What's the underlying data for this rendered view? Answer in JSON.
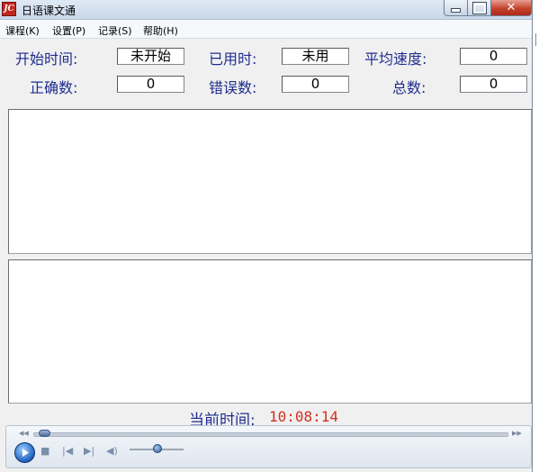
{
  "window": {
    "title": "日语课文通",
    "icon_text": "JC",
    "icon_color": "#c0281e"
  },
  "menu": [
    {
      "label": "课程(K)"
    },
    {
      "label": "设置(P)"
    },
    {
      "label": "记录(S)"
    },
    {
      "label": "帮助(H)"
    }
  ],
  "stats": {
    "start_time": {
      "label": "开始时间:",
      "value": "未开始"
    },
    "elapsed": {
      "label": "已用时:",
      "value": "未用"
    },
    "avg_speed": {
      "label": "平均速度:",
      "value": "0"
    },
    "correct": {
      "label": "正确数:",
      "value": "0"
    },
    "errors": {
      "label": "错误数:",
      "value": "0"
    },
    "total": {
      "label": "总数:",
      "value": "0"
    }
  },
  "clock": {
    "label": "当前时间:",
    "value": "10:08:14"
  },
  "colors": {
    "label_blue": "#1f2d8f",
    "clock_red": "#d0301e"
  },
  "player": {
    "seek_position": 0.0,
    "volume_level": 0.5,
    "icons": [
      "play-icon",
      "stop-icon",
      "previous-icon",
      "next-icon",
      "volume-icon"
    ]
  }
}
